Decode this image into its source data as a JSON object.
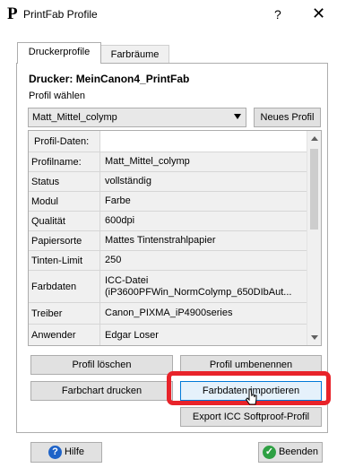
{
  "window": {
    "title": "PrintFab Profile",
    "app_icon_glyph": "P",
    "help_glyph": "?",
    "close_glyph": "✕"
  },
  "tabs": [
    {
      "label": "Druckerprofile",
      "active": true
    },
    {
      "label": "Farbräume",
      "active": false
    }
  ],
  "printer": {
    "label": "Drucker: MeinCanon4_PrintFab",
    "choose_label": "Profil wählen"
  },
  "profile_select": {
    "value": "Matt_Mittel_colymp"
  },
  "buttons": {
    "new_profile": "Neues Profil",
    "delete_profile": "Profil löschen",
    "rename_profile": "Profil umbenennen",
    "print_chart": "Farbchart drucken",
    "import_color_data": "Farbdaten importieren",
    "export_icc": "Export ICC Softproof-Profil",
    "help": "Hilfe",
    "quit": "Beenden"
  },
  "profile_table": {
    "header": "Profil-Daten:",
    "rows": [
      {
        "key": "Profilname:",
        "value": "Matt_Mittel_colymp"
      },
      {
        "key": "Status",
        "value": "vollständig"
      },
      {
        "key": "Modul",
        "value": "Farbe"
      },
      {
        "key": "Qualität",
        "value": "600dpi"
      },
      {
        "key": "Papiersorte",
        "value": "Mattes Tintenstrahlpapier"
      },
      {
        "key": "Tinten-Limit",
        "value": "250"
      },
      {
        "key": "Farbdaten",
        "value_line1": "ICC-Datei",
        "value_line2": "(iP3600PFWin_NormColymp_650DIbAut..."
      },
      {
        "key": "Treiber",
        "value": "Canon_PIXMA_iP4900series"
      },
      {
        "key": "Anwender",
        "value": "Edgar Loser"
      }
    ]
  },
  "colors": {
    "highlight": "#e8232a",
    "help_icon": "#1e63c8",
    "quit_icon": "#2ea043"
  },
  "icons": {
    "help": "question-circle-icon",
    "quit": "check-circle-icon",
    "cursor": "pointer-cursor-icon"
  }
}
